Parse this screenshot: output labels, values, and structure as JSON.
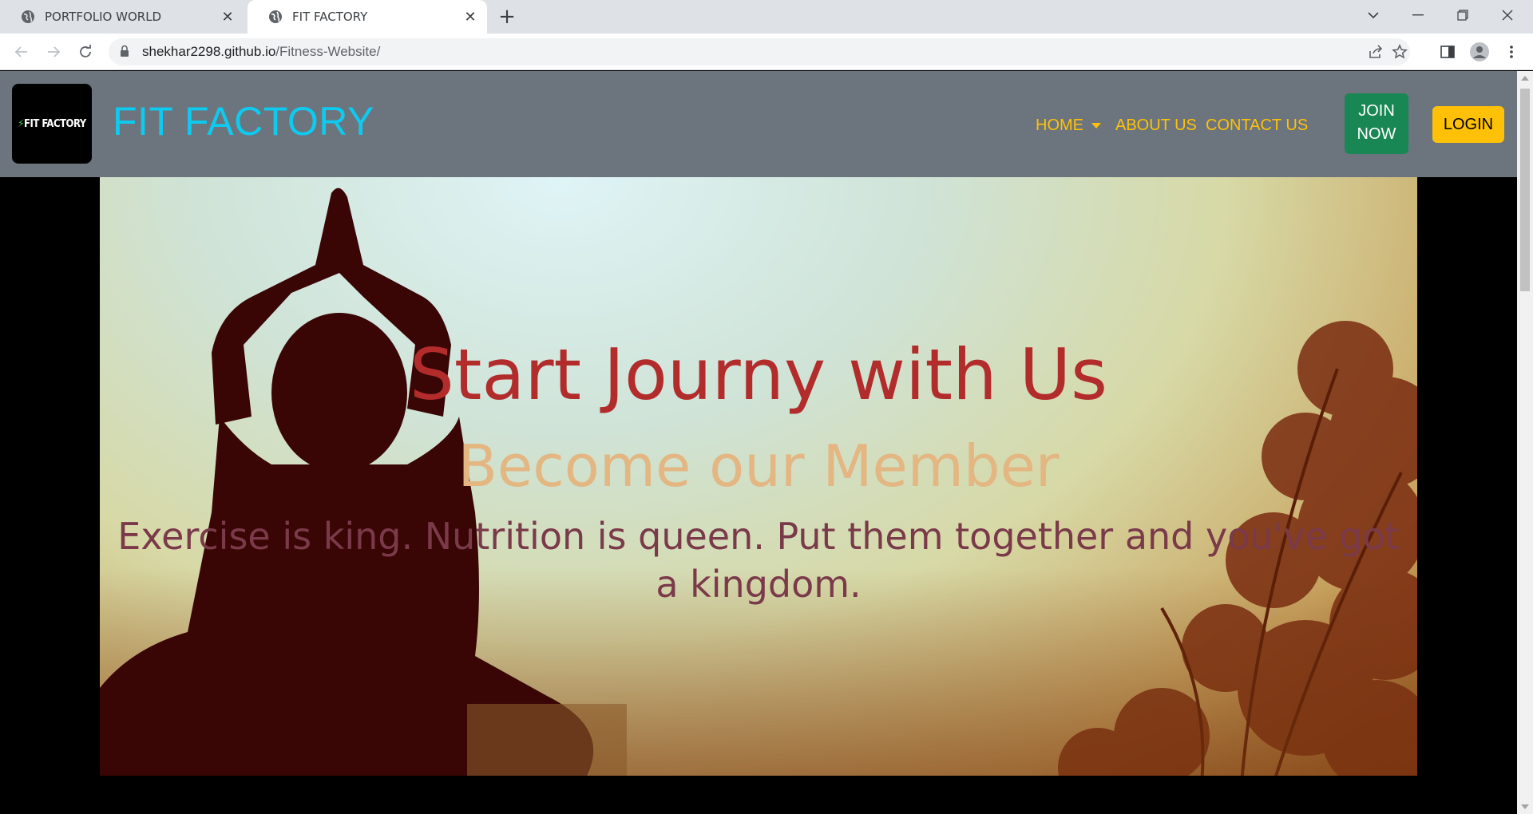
{
  "browser": {
    "tabs": [
      {
        "title": "PORTFOLIO WORLD",
        "active": false
      },
      {
        "title": "FIT FACTORY",
        "active": true
      }
    ],
    "url_host": "shekhar2298.github.io",
    "url_path": "/Fitness-Website/"
  },
  "navbar": {
    "logo_text": "FIT FACTORY",
    "brand": "FIT FACTORY",
    "menu": {
      "home": "HOME",
      "about": "ABOUT US",
      "contact": "CONTACT US"
    },
    "join_line1": "JOIN",
    "join_line2": "NOW",
    "login": "LOGIN"
  },
  "hero": {
    "title": "Start Journy with Us",
    "subtitle": "Become our Member",
    "quote": "Exercise is king. Nutrition is queen. Put them together and you've got a kingdom."
  },
  "colors": {
    "navbar_bg": "#6c757d",
    "brand": "#0dcaf0",
    "menu_text": "#ffc107",
    "join_bg": "#198754",
    "login_bg": "#ffc107",
    "hero_title": "#b22c2c",
    "hero_subtitle": "#e3b682",
    "hero_quote": "#7a3a4a"
  }
}
